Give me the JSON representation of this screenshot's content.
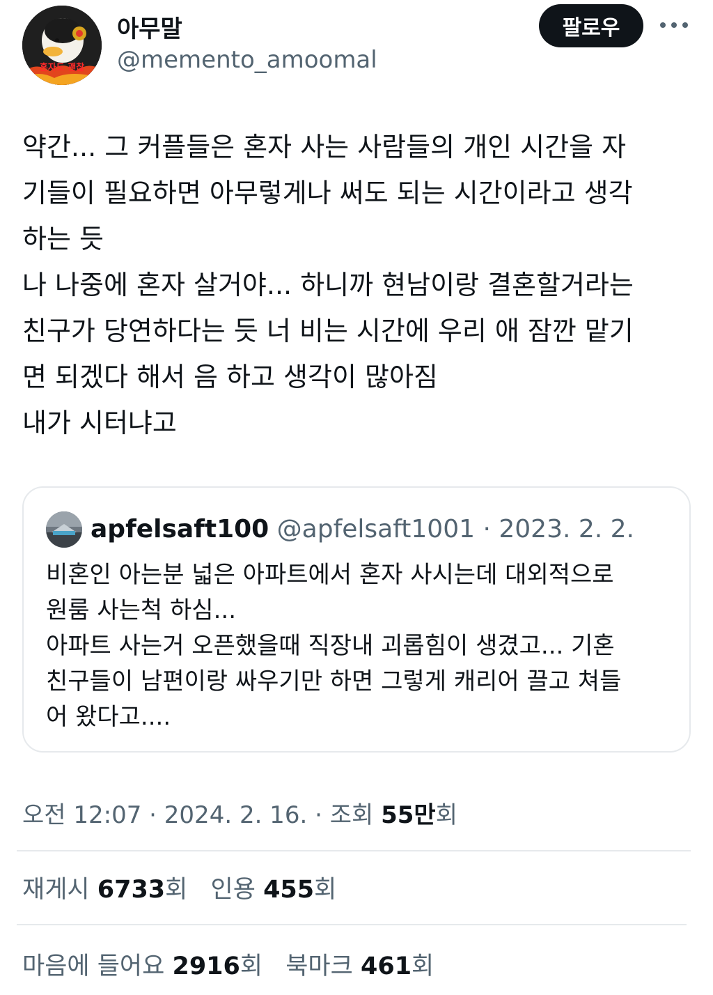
{
  "author": {
    "name": "아무말",
    "handle": "@memento_amoomal",
    "avatar_caption": "혼자도 괜찮"
  },
  "follow_label": "팔로우",
  "tweet": {
    "text": "약간... 그 커플들은 혼자 사는 사람들의 개인 시간을 자\n기들이 필요하면 아무렇게나 써도 되는 시간이라고 생각\n하는 듯\n나 나중에 혼자 살거야... 하니까 현남이랑 결혼할거라는\n친구가 당연하다는 듯 너 비는 시간에 우리 애 잠깐 맡기\n면 되겠다 해서 음 하고 생각이 많아짐\n내가 시터냐고"
  },
  "quote": {
    "name": "apfelsaft100",
    "handle": "@apfelsaft1001",
    "separator": "·",
    "date": "2023. 2. 2.",
    "text": "비혼인 아는분 넓은 아파트에서 혼자 사시는데 대외적으로\n원룸 사는척 하심...\n아파트 사는거 오픈했을때 직장내 괴롭힘이 생겼고... 기혼\n친구들이 남편이랑 싸우기만 하면 그렇게 캐리어 끌고 쳐들\n어 왔다고...."
  },
  "meta": {
    "time": "오전 12:07",
    "sep1": "·",
    "date": "2024. 2. 16.",
    "sep2": "·",
    "views_label": "조회",
    "views_value": "55만",
    "views_suffix": "회"
  },
  "stats": {
    "reposts_label": "재게시",
    "reposts_value": "6733",
    "reposts_suffix": "회",
    "quotes_label": "인용",
    "quotes_value": "455",
    "quotes_suffix": "회",
    "likes_label": "마음에 들어요",
    "likes_value": "2916",
    "likes_suffix": "회",
    "bookmarks_label": "북마크",
    "bookmarks_value": "461",
    "bookmarks_suffix": "회"
  },
  "colors": {
    "text": "#0f1419",
    "secondary": "#536471",
    "border": "#e6e9ec",
    "button": "#0f1419"
  }
}
